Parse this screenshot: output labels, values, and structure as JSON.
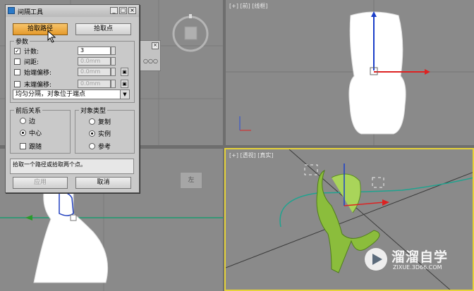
{
  "viewports": {
    "top": {
      "label": ""
    },
    "front": {
      "label": "[+] [前] [线框]"
    },
    "left": {
      "label": ""
    },
    "perspective": {
      "label": "[+] [透视] [真实]"
    },
    "cube_left": "左"
  },
  "dialog": {
    "title": "间隔工具",
    "window_buttons": {
      "minimize": "_",
      "restore": "□",
      "close": "×"
    },
    "pick_path_button": "拾取路径",
    "pick_points_button": "拾取点",
    "params_group": "参数",
    "count_label": "计数:",
    "count_value": "3",
    "spacing_label": "间距:",
    "spacing_value": "0.0mm",
    "start_offset_label": "始端偏移:",
    "start_offset_value": "0.0mm",
    "end_offset_label": "末端偏移:",
    "end_offset_value": "0.0mm",
    "distribution_select": "均匀分隔，对象位于端点",
    "context_group": "前后关系",
    "ctx_edges": "边",
    "ctx_centers": "中心",
    "ctx_follow": "跟随",
    "type_group": "对象类型",
    "type_copy": "复制",
    "type_instance": "实例",
    "type_reference": "参考",
    "prompt_text": "拾取一个路径或拾取两个点。",
    "apply_button": "应用",
    "cancel_button": "取消"
  },
  "watermark": {
    "brand": "溜溜自学",
    "url": "ZIXUE.3D66.COM"
  }
}
